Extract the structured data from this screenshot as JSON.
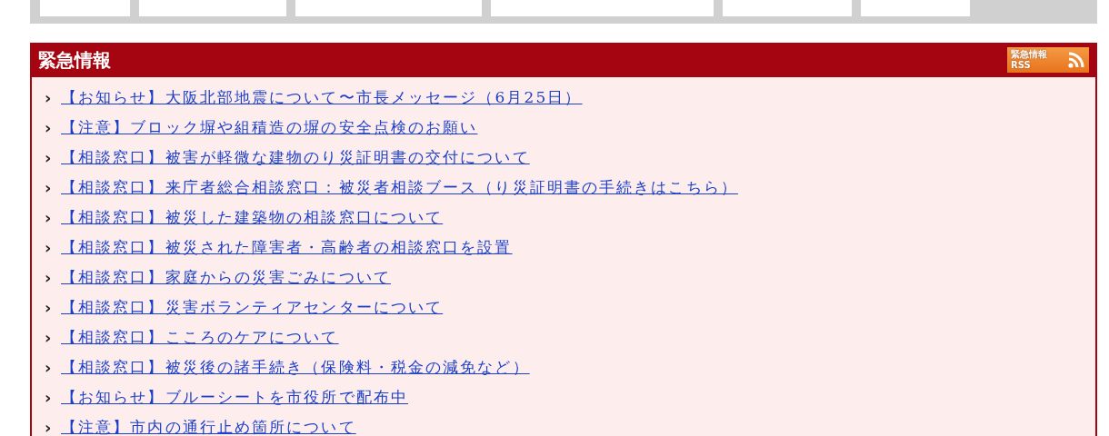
{
  "emergency": {
    "title": "緊急情報",
    "rss_badge": {
      "line_1": "緊急情報",
      "line_2": "RSS"
    },
    "items": [
      {
        "marker": "›",
        "text": "【お知らせ】大阪北部地震について〜市長メッセージ（6月25日）"
      },
      {
        "marker": "›",
        "text": "【注意】ブロック塀や組積造の塀の安全点検のお願い"
      },
      {
        "marker": "›",
        "text": "【相談窓口】被害が軽微な建物のり災証明書の交付について"
      },
      {
        "marker": "›",
        "text": "【相談窓口】来庁者総合相談窓口：被災者相談ブース（り災証明書の手続きはこちら）"
      },
      {
        "marker": "›",
        "text": "【相談窓口】被災した建築物の相談窓口について"
      },
      {
        "marker": "›",
        "text": "【相談窓口】被災された障害者・高齢者の相談窓口を設置"
      },
      {
        "marker": "›",
        "text": "【相談窓口】家庭からの災害ごみについて"
      },
      {
        "marker": "›",
        "text": "【相談窓口】災害ボランティアセンターについて"
      },
      {
        "marker": "›",
        "text": "【相談窓口】こころのケアについて"
      },
      {
        "marker": "›",
        "text": "【相談窓口】被災後の諸手続き（保険料・税金の減免など）"
      },
      {
        "marker": "›",
        "text": "【お知らせ】ブルーシートを市役所で配布中"
      },
      {
        "marker": "›",
        "text": "【注意】市内の通行止め箇所について"
      }
    ]
  }
}
